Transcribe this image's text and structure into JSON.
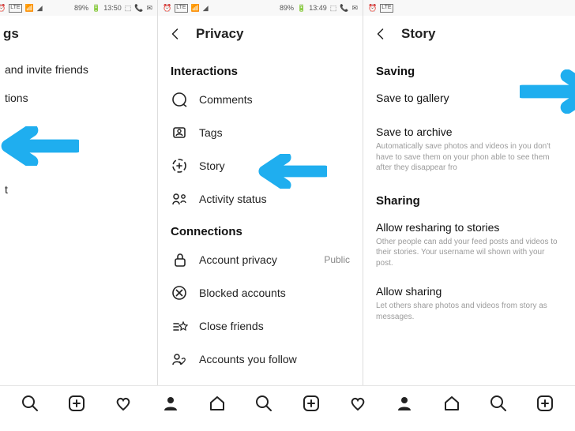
{
  "status": {
    "left": [
      "⏰",
      "LTE",
      "wifi",
      "signal"
    ],
    "battery": "89%",
    "time1": "13:50",
    "time2": "13:49",
    "right_app_icons": [
      "msg",
      "phone",
      "env"
    ]
  },
  "arrow_color": "#1faeef",
  "screen1": {
    "title_partial": "gs",
    "items": [
      {
        "label": "and invite friends"
      },
      {
        "label": "tions"
      },
      {
        "label": ""
      },
      {
        "label": ""
      },
      {
        "label": "t"
      },
      {
        "label": ""
      }
    ]
  },
  "screen2": {
    "title": "Privacy",
    "section1": "Interactions",
    "items1": [
      {
        "icon": "comment",
        "label": "Comments"
      },
      {
        "icon": "tags",
        "label": "Tags"
      },
      {
        "icon": "story",
        "label": "Story"
      },
      {
        "icon": "activity",
        "label": "Activity status"
      }
    ],
    "section2": "Connections",
    "items2": [
      {
        "icon": "lock",
        "label": "Account privacy",
        "trail": "Public"
      },
      {
        "icon": "blocked",
        "label": "Blocked accounts"
      },
      {
        "icon": "closefriends",
        "label": "Close friends"
      },
      {
        "icon": "follow",
        "label": "Accounts you follow"
      }
    ]
  },
  "screen3": {
    "title": "Story",
    "section1": "Saving",
    "save_gallery": "Save to gallery",
    "save_archive": "Save to archive",
    "archive_desc": "Automatically save photos and videos in you don't have to save them on your phon able to see them after they disappear fro",
    "section2": "Sharing",
    "reshare": "Allow resharing to stories",
    "reshare_desc": "Other people can add your feed posts and videos to their stories. Your username wil shown with your post.",
    "allow_sharing": "Allow sharing",
    "allow_sharing_desc": "Let others share photos and videos from story as messages."
  },
  "bottombar_icons": [
    "search",
    "add",
    "heart",
    "profile",
    "home",
    "search",
    "add",
    "heart",
    "profile",
    "home",
    "search",
    "add"
  ]
}
